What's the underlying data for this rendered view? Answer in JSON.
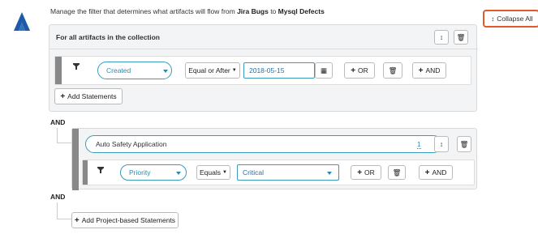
{
  "logo": {
    "icon": "atlassian-logo"
  },
  "header": {
    "text_prefix": "Manage the filter that determines what artifacts will flow from ",
    "source": "Jira Bugs",
    "text_mid": " to ",
    "target": "Mysql Defects"
  },
  "collapse_all": {
    "icon": "updown-arrows-icon",
    "label": "Collapse All",
    "border_color": "#e05a2b"
  },
  "collection_block": {
    "title": "For all artifacts in the collection",
    "statement": {
      "field": "Created",
      "operator": "Equal or After",
      "value": "2018-05-15",
      "or_label": "OR",
      "and_label": "AND"
    },
    "add_statements_label": "Add Statements"
  },
  "connector_and_1": "AND",
  "project_block": {
    "project_name": "Auto Safety Application",
    "count": "1",
    "statement": {
      "field": "Priority",
      "operator": "Equals",
      "value": "Critical",
      "or_label": "OR",
      "and_label": "AND"
    }
  },
  "connector_and_2": "AND",
  "add_project_label": "Add Project-based Statements",
  "colors": {
    "accent": "#3a9bb8",
    "logo": "#1e5aa8"
  }
}
